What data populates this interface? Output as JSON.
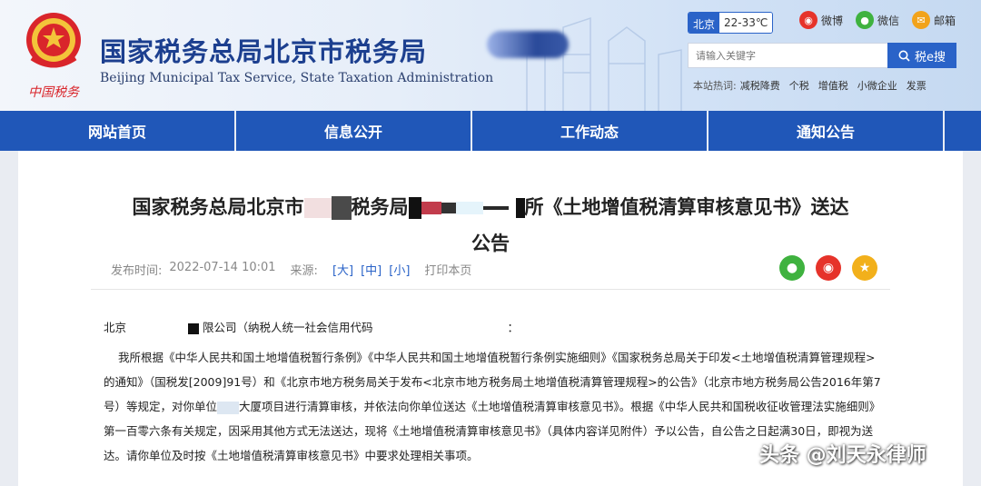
{
  "header": {
    "title": "国家税务总局北京市税务局",
    "subtitle": "Beijing Municipal Tax Service, State Taxation Administration",
    "emblem_text": "中国税务",
    "weather": {
      "city": "北京",
      "temp": "22-33℃"
    },
    "social": [
      {
        "label": "微博",
        "icon": "weibo-icon",
        "color": "#e6332a"
      },
      {
        "label": "微信",
        "icon": "wechat-icon",
        "color": "#3fb23f"
      },
      {
        "label": "邮箱",
        "icon": "mail-icon",
        "color": "#f2a31b"
      }
    ],
    "search": {
      "placeholder": "请输入关键字",
      "button_label": "税e搜"
    },
    "hotwords": {
      "label": "本站热词:",
      "items": [
        "减税降费",
        "个税",
        "增值税",
        "小微企业",
        "发票"
      ]
    }
  },
  "nav": {
    "items": [
      "网站首页",
      "信息公开",
      "工作动态",
      "通知公告"
    ]
  },
  "article": {
    "title_line1_a": "国家税务总局北京市",
    "title_line1_b": "税务局",
    "title_line1_c": "所《土地增值税清算审核意见书》送达",
    "title_line2": "公告",
    "meta": {
      "publish_label": "发布时间:",
      "publish_time": "2022-07-14 10:01",
      "source_label": "来源:",
      "size_large": "[大]",
      "size_medium": "[中]",
      "size_small": "[小]",
      "print": "打印本页"
    },
    "addressee_a": "北京",
    "addressee_b": "限公司（纳税人统一社会信用代码",
    "addressee_c": "：",
    "para_1": "我所根据《中华人民共和国土地增值税暂行条例》《中华人民共和国土地增值税暂行条例实施细则》《国家税务总局关于印发<土地增值税清算管理规程>的通知》（国税发[2009]91号）和《北京市地方税务局关于发布<北京市地方税务局土地增值税清算管理规程>的公告》（北京市地方税务局公告2016年第7号）等规定，对你单位",
    "para_2": "大厦项目进行清算审核，并依法向你单位送达《土地增值税清算审核意见书》。根据《中华人民共和国税收征收管理法实施细则》第一百零六条有关规定，因采用其他方式无法送达，现将《土地增值税清算审核意见书》（具体内容详见附件）予以公告，自公告之日起满30日，即视为送达。请你单位及时按《土地增值税清算审核意见书》中要求处理相关事项。"
  },
  "share_icons": [
    {
      "icon": "wechat-share-icon",
      "color": "#3fb23f"
    },
    {
      "icon": "weibo-share-icon",
      "color": "#e6332a"
    },
    {
      "icon": "favorite-star-icon",
      "color": "#f2b01b"
    }
  ],
  "watermark": "头条 @刘天永律师"
}
